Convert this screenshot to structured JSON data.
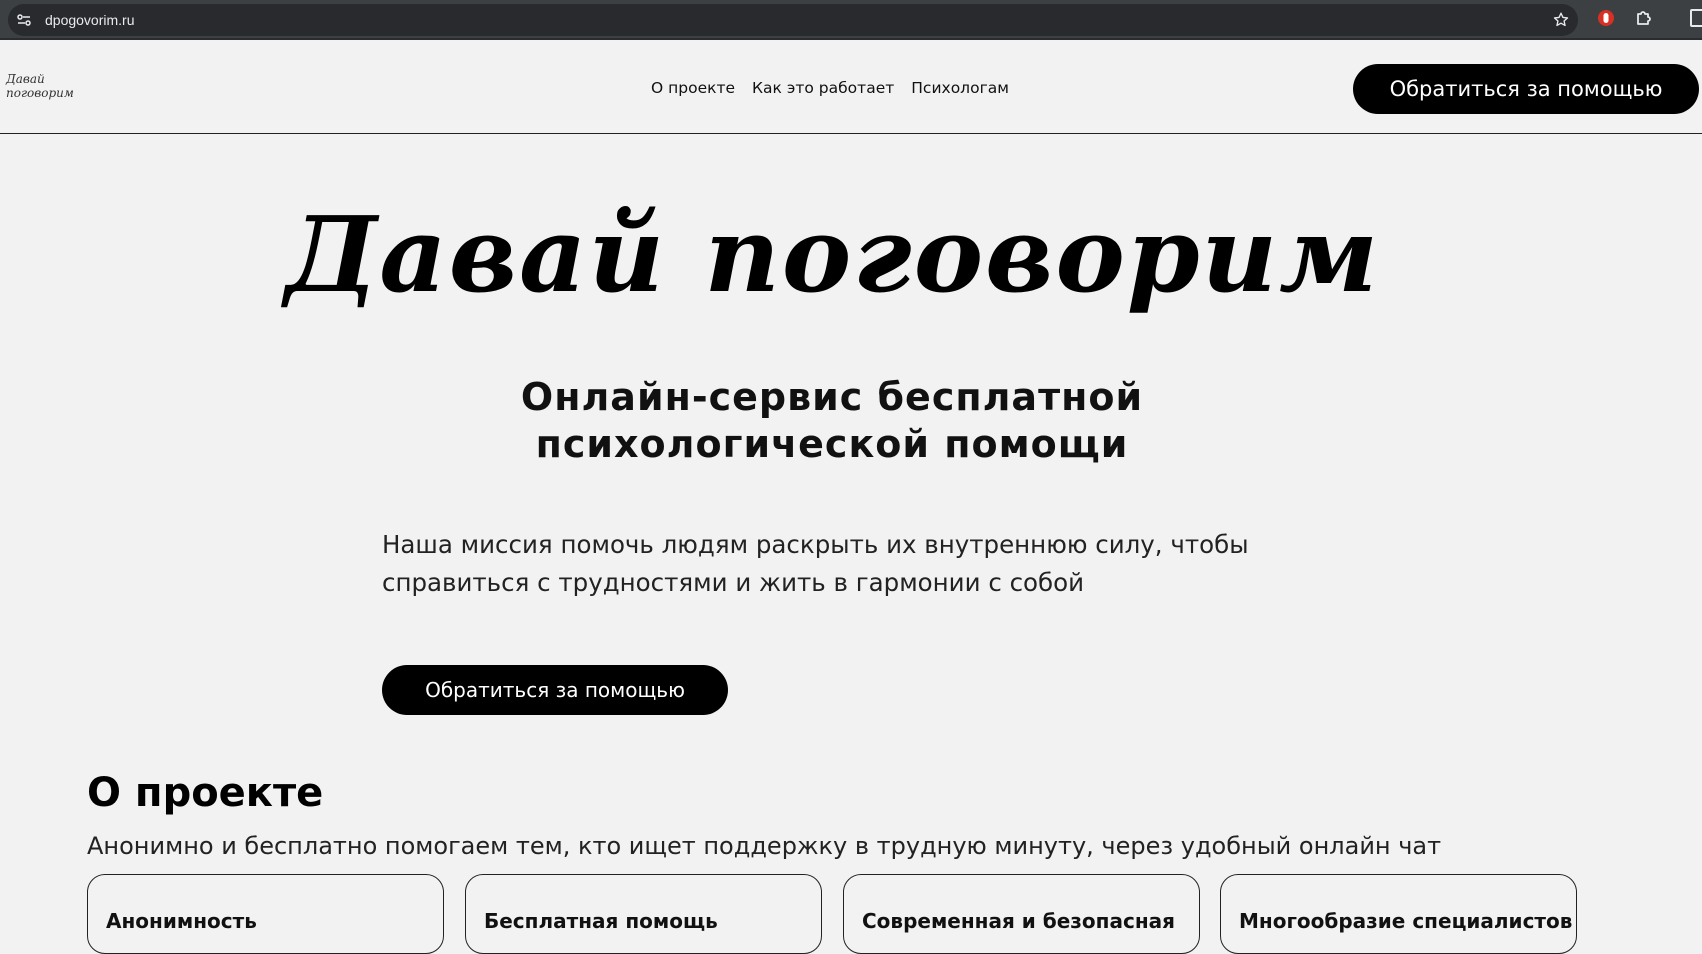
{
  "browser": {
    "url": "dpogovorim.ru"
  },
  "header": {
    "logo_line1": "Давай",
    "logo_line2": "поговорим",
    "nav": [
      {
        "label": "О проекте"
      },
      {
        "label": "Как это работает"
      },
      {
        "label": "Психологам"
      }
    ],
    "cta_label": "Обратиться за помощью"
  },
  "hero": {
    "title": "Давай поговорим",
    "subtitle": "Онлайн-сервис бесплатной психологической помощи",
    "mission": "Наша миссия помочь людям раскрыть их внутреннюю силу, чтобы справиться с трудностями и жить в гармонии с собой",
    "cta_label": "Обратиться за помощью"
  },
  "about": {
    "heading": "О проекте",
    "description": "Анонимно и бесплатно помогаем тем, кто ищет поддержку в трудную минуту, через удобный онлайн чат",
    "cards": [
      {
        "title": "Анонимность"
      },
      {
        "title": "Бесплатная помощь"
      },
      {
        "title": "Современная и безопасная"
      },
      {
        "title": "Многообразие специалистов"
      }
    ]
  },
  "colors": {
    "page_bg": "#f2f2f2",
    "button_bg": "#000000",
    "button_text": "#ffffff",
    "chrome_bg": "#3c4043"
  }
}
